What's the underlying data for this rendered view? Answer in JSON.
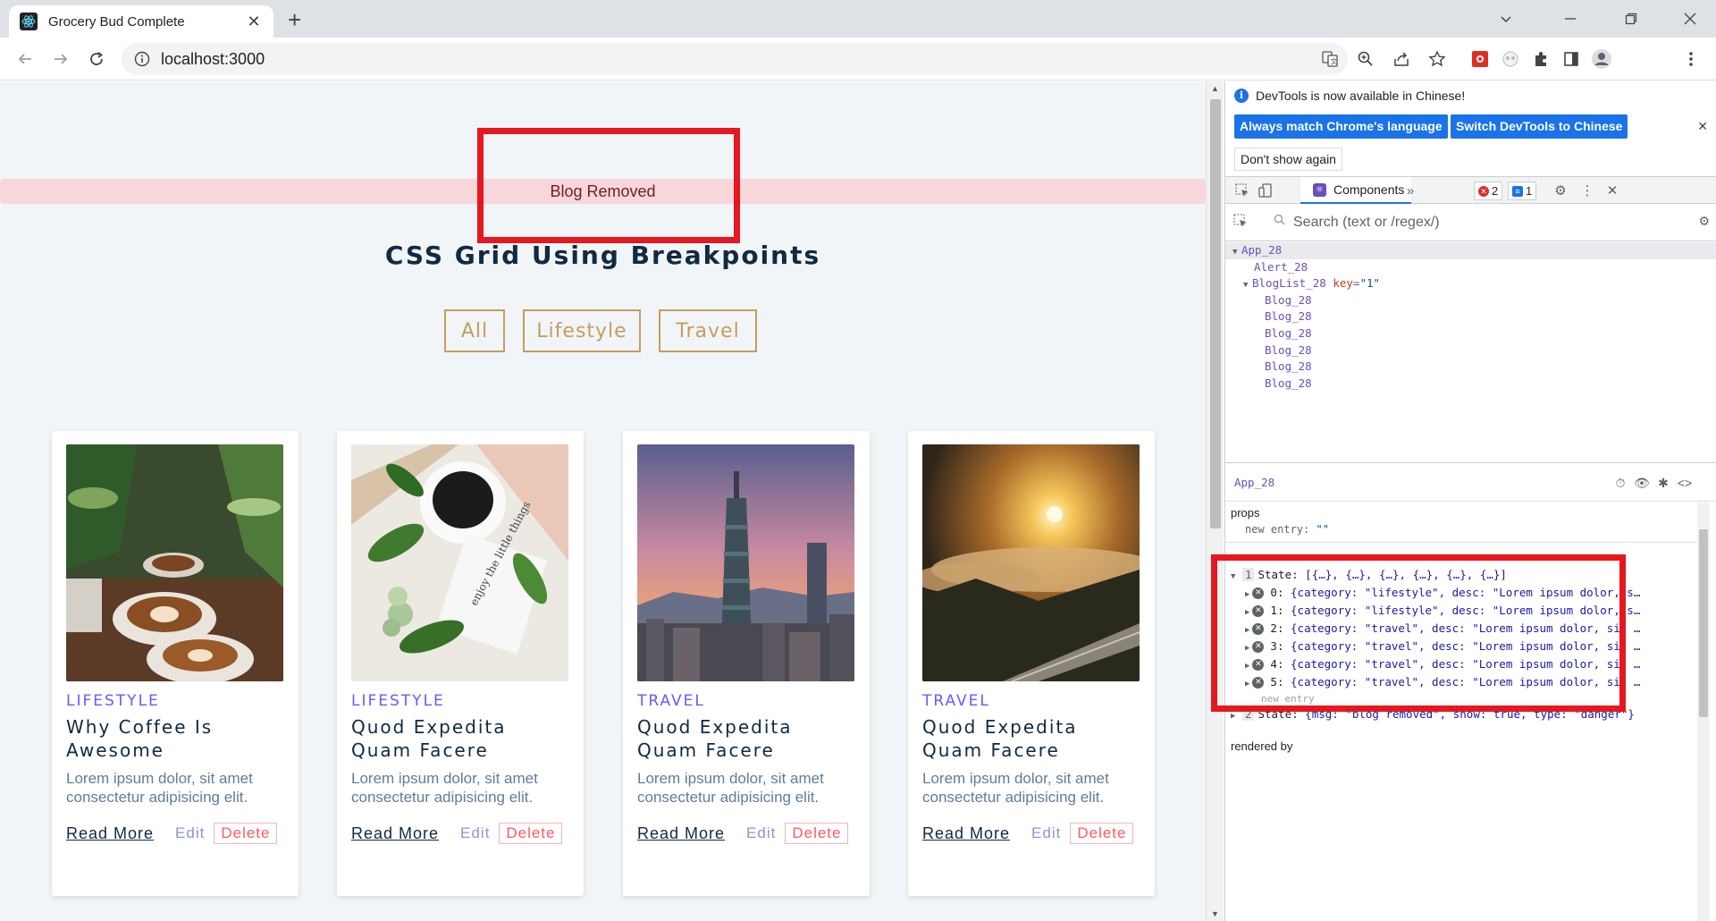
{
  "browser": {
    "tab_title": "Grocery Bud Complete",
    "url": "localhost:3000"
  },
  "page": {
    "alert": "Blog Removed",
    "title": "CSS Grid Using Breakpoints",
    "filters": [
      "All",
      "Lifestyle",
      "Travel"
    ],
    "cards": [
      {
        "category": "LIFESTYLE",
        "title": "Why Coffee Is Awesome",
        "desc": "Lorem ipsum dolor, sit amet consectetur adipisicing elit.",
        "read": "Read More",
        "edit": "Edit",
        "delete": "Delete",
        "image": "coffee-cups"
      },
      {
        "category": "LIFESTYLE",
        "title": "Quod Expedita Quam Facere",
        "desc": "Lorem ipsum dolor, sit amet consectetur adipisicing elit.",
        "read": "Read More",
        "edit": "Edit",
        "delete": "Delete",
        "image": "coffee-flatlay"
      },
      {
        "category": "TRAVEL",
        "title": "Quod Expedita Quam Facere",
        "desc": "Lorem ipsum dolor, sit amet consectetur adipisicing elit.",
        "read": "Read More",
        "edit": "Edit",
        "delete": "Delete",
        "image": "city-tower"
      },
      {
        "category": "TRAVEL",
        "title": "Quod Expedita Quam Facere",
        "desc": "Lorem ipsum dolor, sit amet consectetur adipisicing elit.",
        "read": "Read More",
        "edit": "Edit",
        "delete": "Delete",
        "image": "mountain-sunset"
      }
    ]
  },
  "devtools": {
    "info_message": "DevTools is now available in Chinese!",
    "btn_match": "Always match Chrome's language",
    "btn_switch": "Switch DevTools to Chinese",
    "btn_dont_show": "Don't show again",
    "tab_components": "Components",
    "error_count": "2",
    "message_count": "1",
    "search_placeholder": "Search (text or /regex/)",
    "tree": {
      "root": "App_28",
      "alert": "Alert_28",
      "bloglist": "BlogList_28",
      "bloglist_key_name": "key",
      "bloglist_key_value": "\"1\"",
      "blogs": [
        "Blog_28",
        "Blog_28",
        "Blog_28",
        "Blog_28",
        "Blog_28",
        "Blog_28"
      ]
    },
    "selected_component": "App_28",
    "props_header": "props",
    "props_entry_key": "new entry:",
    "props_entry_val": "\"\"",
    "hooks": {
      "state1_label": "State:",
      "state1_value": "[{…}, {…}, {…}, {…}, {…}, {…}]",
      "items": [
        {
          "idx": "0:",
          "text": "{category: \"lifestyle\", desc: \"Lorem ipsum dolor, s…"
        },
        {
          "idx": "1:",
          "text": "{category: \"lifestyle\", desc: \"Lorem ipsum dolor, s…"
        },
        {
          "idx": "2:",
          "text": "{category: \"travel\", desc: \"Lorem ipsum dolor, sit …"
        },
        {
          "idx": "3:",
          "text": "{category: \"travel\", desc: \"Lorem ipsum dolor, sit …"
        },
        {
          "idx": "4:",
          "text": "{category: \"travel\", desc: \"Lorem ipsum dolor, sit …"
        },
        {
          "idx": "5:",
          "text": "{category: \"travel\", desc: \"Lorem ipsum dolor, sit …"
        }
      ],
      "new_entry": "new entry",
      "state2_label": "State:",
      "state2_value": "{msg: \"blog removed\", show: true, type: \"danger\"}"
    },
    "rendered_by": "rendered by"
  }
}
